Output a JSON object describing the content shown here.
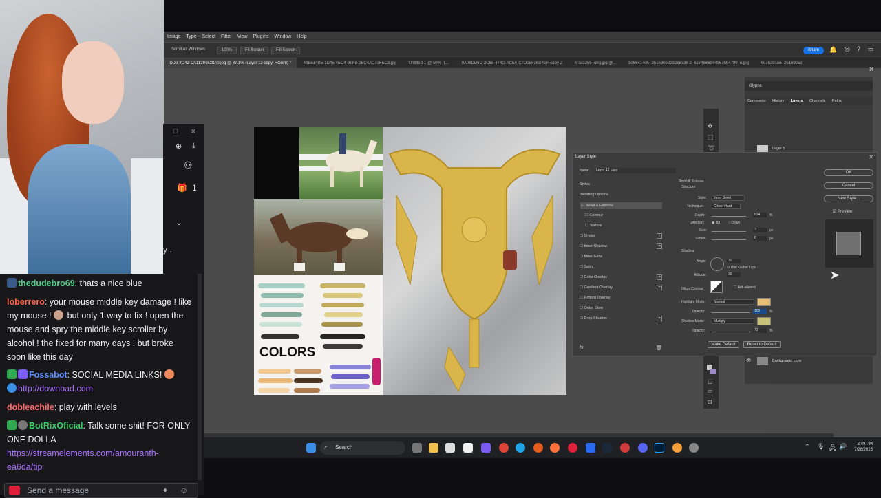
{
  "photoshop": {
    "menu": [
      "Image",
      "Type",
      "Select",
      "Filter",
      "View",
      "Plugins",
      "Window",
      "Help"
    ],
    "options": {
      "scroll_all": "Scroll All Windows",
      "zoom": "100%",
      "fit": "Fit Screen",
      "fill": "Fill Screen"
    },
    "share_label": "Share",
    "tabs": [
      "iDD9-8D42-CA11394828A0.jpg @ 87.1% (Layer 12 copy, RGB/8) *",
      "48E614BE-1D45-4EC4-B0F8-2EC4AD73FEC3.jpg",
      "Untitled-1 @ 50% (L...",
      "9A06DD6D-2C65-474D-AC5A-C7D05F26D4EF copy 2",
      "6f7a3255_orig.jpg @...",
      "506641405_2516905203268336 2_6274866944957594799_n.jpg",
      "507539156_25169052"
    ],
    "artwork_label": "COLORS",
    "panels": {
      "glyphs": "Glyphs",
      "tabs": [
        "Comments",
        "History",
        "Layers",
        "Channels",
        "Paths"
      ],
      "layer5": "Layer 5",
      "bg_copy": "Background copy"
    }
  },
  "dialog": {
    "title": "Layer Style",
    "name_label": "Name:",
    "name_value": "Layer 12 copy",
    "styles_header": "Styles",
    "styles": [
      {
        "label": "Blending Options",
        "checked": false,
        "plus": false
      },
      {
        "label": "Bevel & Emboss",
        "checked": true,
        "plus": false
      },
      {
        "label": "Contour",
        "checked": false,
        "plus": false
      },
      {
        "label": "Texture",
        "checked": false,
        "plus": false
      },
      {
        "label": "Stroke",
        "checked": false,
        "plus": true
      },
      {
        "label": "Inner Shadow",
        "checked": false,
        "plus": true
      },
      {
        "label": "Inner Glow",
        "checked": false,
        "plus": false
      },
      {
        "label": "Satin",
        "checked": false,
        "plus": false
      },
      {
        "label": "Color Overlay",
        "checked": false,
        "plus": true
      },
      {
        "label": "Gradient Overlay",
        "checked": false,
        "plus": true
      },
      {
        "label": "Pattern Overlay",
        "checked": false,
        "plus": false
      },
      {
        "label": "Outer Glow",
        "checked": false,
        "plus": false
      },
      {
        "label": "Drop Shadow",
        "checked": false,
        "plus": true
      }
    ],
    "bevel": {
      "section": "Bevel & Emboss",
      "structure": "Structure",
      "style_label": "Style:",
      "style_value": "Inner Bevel",
      "technique_label": "Technique:",
      "technique_value": "Chisel Hard",
      "depth_label": "Depth:",
      "depth_value": "834",
      "depth_unit": "%",
      "direction_label": "Direction:",
      "dir_up": "Up",
      "dir_down": "Down",
      "size_label": "Size:",
      "size_value": "3",
      "size_unit": "px",
      "soften_label": "Soften:",
      "soften_value": "0",
      "soften_unit": "px",
      "shading": "Shading",
      "angle_label": "Angle:",
      "angle_value": "30",
      "global_light": "Use Global Light",
      "altitude_label": "Altitude:",
      "altitude_value": "30",
      "gloss_label": "Gloss Contour:",
      "anti_aliased": "Anti-aliased",
      "highlight_label": "Highlight Mode:",
      "highlight_value": "Normal",
      "hl_opacity_label": "Opacity:",
      "hl_opacity_value": "100",
      "hl_unit": "%",
      "shadow_label": "Shadow Mode:",
      "shadow_value": "Multiply",
      "sh_opacity_label": "Opacity:",
      "sh_opacity_value": "72",
      "sh_unit": "%",
      "make_default": "Make Default",
      "reset_default": "Reset to Default",
      "highlight_color": "#e8c07a",
      "shadow_color": "#c8c27a"
    },
    "buttons": {
      "ok": "OK",
      "cancel": "Cancel",
      "new_style": "New Style...",
      "preview": "Preview"
    }
  },
  "chat": {
    "partial_line": "y .",
    "badge_count": "1",
    "messages": [
      {
        "user": "thedudebro69",
        "color": "#4fd08a",
        "text": ": thats a nice blue"
      },
      {
        "user": "loberrero",
        "color": "#ff6a4d",
        "text": ": your mouse middle key damage ! like my mouse !",
        "text2": "but only 1 way to fix ! open the mouse and spry the middle key scroller by alcohol ! the fixed for many days ! but broke soon like this day"
      },
      {
        "user": "Fossabot",
        "color": "#5b8cff",
        "text": ": SOCIAL MEDIA LINKS!",
        "link": "http://downbad.com"
      },
      {
        "user": "dobleachile",
        "color": "#ff6a6a",
        "text": ": play with levels"
      },
      {
        "user": "BotRixOficial",
        "color": "#3ad06a",
        "text": ": Talk some shit! FOR ONLY ONE DOLLA",
        "link": "https://streamelements.com/amouranth-ea6da/tip"
      }
    ],
    "input_placeholder": "Send a message"
  },
  "taskbar": {
    "search": "Search",
    "time": "3:49 PM",
    "date": "7/28/2025"
  }
}
